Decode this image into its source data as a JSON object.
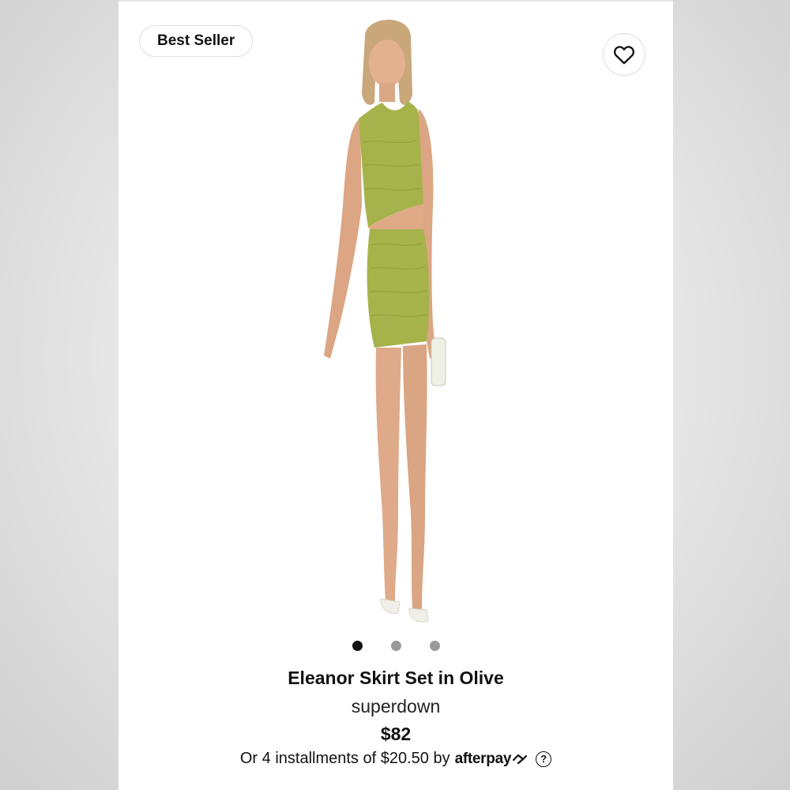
{
  "product": {
    "badge": "Best Seller",
    "title": "Eleanor Skirt Set in Olive",
    "brand": "superdown",
    "price": "$82",
    "installments_prefix": "Or 4 installments of $20.50 by",
    "payment_provider": "afterpay",
    "help_glyph": "?",
    "garment_color": "#a6b34a"
  },
  "gallery": {
    "slide_count": 3,
    "active_index": 0
  },
  "icons": {
    "favorite": "heart-icon",
    "help": "question-circle-icon",
    "provider": "afterpay-arrows-icon"
  }
}
